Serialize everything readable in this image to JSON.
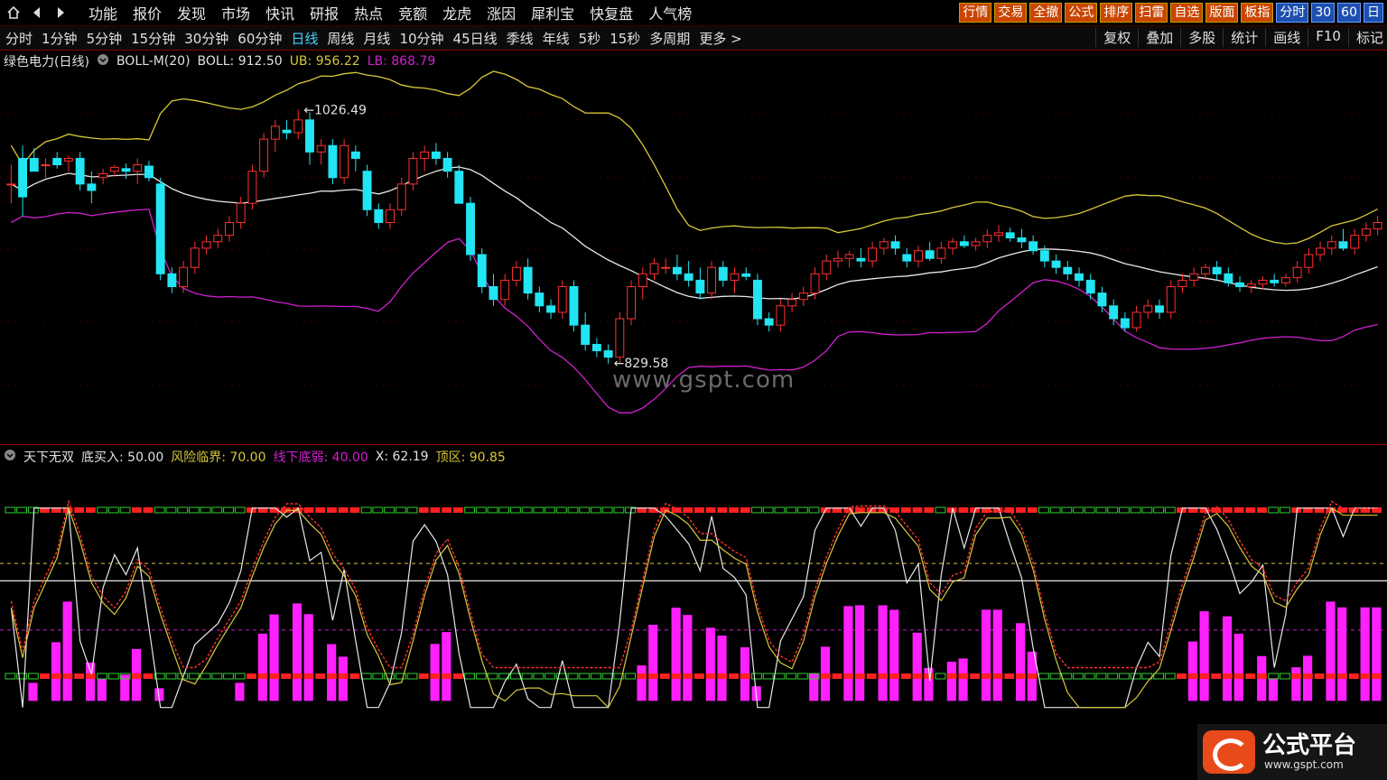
{
  "topbar": {
    "menu": [
      "功能",
      "报价",
      "发现",
      "市场",
      "快讯",
      "研报",
      "热点",
      "竞额",
      "龙虎",
      "涨因",
      "犀利宝",
      "快复盘",
      "人气榜"
    ],
    "buttons": [
      "行情",
      "交易",
      "全撤",
      "公式",
      "排序",
      "扫雷",
      "自选",
      "版面",
      "板指",
      "分时",
      "30",
      "60",
      "日"
    ]
  },
  "toolbar": {
    "periods": [
      "分时",
      "1分钟",
      "5分钟",
      "15分钟",
      "30分钟",
      "60分钟",
      "日线",
      "周线",
      "月线",
      "10分钟",
      "45日线",
      "季线",
      "年线",
      "5秒",
      "15秒",
      "多周期",
      "更多 >"
    ],
    "active": "日线",
    "right": [
      "复权",
      "叠加",
      "多股",
      "统计",
      "画线",
      "F10",
      "标记"
    ]
  },
  "main_legend": {
    "stock": "绿色电力(日线)",
    "indicator": "BOLL-M(20)",
    "boll": "BOLL: 912.50",
    "ub": "UB: 956.22",
    "lb": "LB: 868.79"
  },
  "price_labels": {
    "high": "1026.49",
    "low": "829.58"
  },
  "watermark": "www.gspt.com",
  "sub_legend": {
    "name": "天下无双",
    "buy": "底买入: 50.00",
    "risk": "风险临界: 70.00",
    "weak": "线下底弱: 40.00",
    "x": "X: 62.19",
    "top": "顶区: 90.85"
  },
  "logo": {
    "title": "公式平台",
    "url": "www.gspt.com"
  },
  "colors": {
    "up": "#ff3030",
    "down": "#22e4f2",
    "ub": "#d8c838",
    "mid": "#e8e8e8",
    "lb": "#d020d0",
    "accent": "#3fd2ff"
  },
  "chart_data": {
    "type": "candlestick",
    "title": "绿色电力(日线)",
    "indicator": "BOLL-M(20)",
    "boll": 912.5,
    "ub": 956.22,
    "lb": 868.79,
    "high_marker": 1026.49,
    "low_marker": 829.58,
    "candles": [
      [
        970,
        985,
        955,
        970
      ],
      [
        990,
        1000,
        945,
        960
      ],
      [
        990,
        998,
        980,
        980
      ],
      [
        985,
        990,
        975,
        985
      ],
      [
        990,
        995,
        982,
        985
      ],
      [
        988,
        992,
        980,
        990
      ],
      [
        990,
        995,
        965,
        970
      ],
      [
        970,
        980,
        955,
        965
      ],
      [
        975,
        982,
        970,
        978
      ],
      [
        980,
        985,
        976,
        983
      ],
      [
        982,
        986,
        974,
        980
      ],
      [
        980,
        990,
        970,
        985
      ],
      [
        984,
        988,
        972,
        975
      ],
      [
        970,
        975,
        895,
        900
      ],
      [
        900,
        905,
        885,
        890
      ],
      [
        890,
        910,
        885,
        905
      ],
      [
        905,
        925,
        900,
        920
      ],
      [
        920,
        930,
        915,
        925
      ],
      [
        925,
        935,
        920,
        930
      ],
      [
        930,
        945,
        925,
        940
      ],
      [
        940,
        960,
        935,
        955
      ],
      [
        955,
        985,
        950,
        980
      ],
      [
        980,
        1010,
        975,
        1005
      ],
      [
        1005,
        1020,
        995,
        1015
      ],
      [
        1012,
        1020,
        1005,
        1010
      ],
      [
        1010,
        1028,
        1005,
        1020
      ],
      [
        1020,
        1026,
        985,
        995
      ],
      [
        995,
        1005,
        985,
        1000
      ],
      [
        1000,
        1005,
        970,
        975
      ],
      [
        975,
        1005,
        970,
        1000
      ],
      [
        995,
        1000,
        980,
        990
      ],
      [
        980,
        985,
        945,
        950
      ],
      [
        950,
        955,
        935,
        940
      ],
      [
        940,
        955,
        935,
        950
      ],
      [
        950,
        975,
        945,
        970
      ],
      [
        970,
        995,
        965,
        990
      ],
      [
        990,
        1000,
        980,
        995
      ],
      [
        995,
        1002,
        985,
        990
      ],
      [
        990,
        995,
        975,
        980
      ],
      [
        980,
        985,
        960,
        955
      ],
      [
        955,
        960,
        910,
        915
      ],
      [
        915,
        920,
        885,
        890
      ],
      [
        890,
        900,
        875,
        880
      ],
      [
        880,
        900,
        875,
        895
      ],
      [
        895,
        910,
        890,
        905
      ],
      [
        905,
        912,
        880,
        885
      ],
      [
        885,
        890,
        870,
        875
      ],
      [
        875,
        880,
        865,
        870
      ],
      [
        870,
        895,
        865,
        890
      ],
      [
        890,
        895,
        855,
        860
      ],
      [
        860,
        870,
        840,
        845
      ],
      [
        845,
        850,
        835,
        840
      ],
      [
        840,
        845,
        830,
        835
      ],
      [
        835,
        870,
        830,
        865
      ],
      [
        865,
        895,
        860,
        890
      ],
      [
        890,
        905,
        880,
        900
      ],
      [
        900,
        912,
        895,
        908
      ],
      [
        905,
        912,
        900,
        905
      ],
      [
        905,
        915,
        895,
        900
      ],
      [
        900,
        910,
        890,
        895
      ],
      [
        895,
        905,
        880,
        885
      ],
      [
        885,
        910,
        880,
        905
      ],
      [
        905,
        910,
        890,
        895
      ],
      [
        895,
        905,
        885,
        900
      ],
      [
        900,
        905,
        895,
        898
      ],
      [
        895,
        900,
        860,
        865
      ],
      [
        865,
        870,
        855,
        860
      ],
      [
        860,
        880,
        855,
        875
      ],
      [
        875,
        885,
        870,
        880
      ],
      [
        880,
        890,
        875,
        885
      ],
      [
        885,
        905,
        880,
        900
      ],
      [
        900,
        915,
        895,
        910
      ],
      [
        910,
        918,
        905,
        912
      ],
      [
        912,
        918,
        905,
        915
      ],
      [
        912,
        920,
        905,
        910
      ],
      [
        910,
        925,
        905,
        920
      ],
      [
        920,
        928,
        915,
        925
      ],
      [
        925,
        930,
        915,
        920
      ],
      [
        915,
        920,
        905,
        910
      ],
      [
        910,
        922,
        905,
        918
      ],
      [
        918,
        925,
        910,
        912
      ],
      [
        912,
        925,
        908,
        920
      ],
      [
        920,
        928,
        915,
        925
      ],
      [
        925,
        930,
        920,
        922
      ],
      [
        922,
        928,
        918,
        925
      ],
      [
        925,
        935,
        920,
        930
      ],
      [
        930,
        938,
        925,
        932
      ],
      [
        932,
        936,
        925,
        928
      ],
      [
        928,
        935,
        920,
        925
      ],
      [
        925,
        930,
        915,
        918
      ],
      [
        918,
        922,
        905,
        910
      ],
      [
        910,
        915,
        900,
        905
      ],
      [
        905,
        910,
        895,
        900
      ],
      [
        900,
        905,
        890,
        895
      ],
      [
        895,
        900,
        880,
        885
      ],
      [
        885,
        890,
        870,
        875
      ],
      [
        875,
        880,
        860,
        865
      ],
      [
        865,
        870,
        855,
        858
      ],
      [
        858,
        875,
        855,
        870
      ],
      [
        870,
        880,
        865,
        875
      ],
      [
        875,
        880,
        865,
        870
      ],
      [
        870,
        895,
        865,
        890
      ],
      [
        890,
        900,
        885,
        895
      ],
      [
        895,
        905,
        890,
        900
      ],
      [
        900,
        908,
        895,
        905
      ],
      [
        905,
        910,
        895,
        900
      ],
      [
        900,
        905,
        890,
        893
      ],
      [
        893,
        898,
        886,
        890
      ],
      [
        890,
        895,
        885,
        892
      ],
      [
        892,
        898,
        888,
        895
      ],
      [
        895,
        900,
        890,
        893
      ],
      [
        893,
        900,
        890,
        897
      ],
      [
        897,
        910,
        893,
        905
      ],
      [
        905,
        920,
        900,
        915
      ],
      [
        915,
        925,
        910,
        920
      ],
      [
        920,
        930,
        915,
        925
      ],
      [
        925,
        935,
        918,
        920
      ],
      [
        920,
        935,
        915,
        930
      ],
      [
        930,
        940,
        925,
        935
      ],
      [
        935,
        945,
        930,
        940
      ]
    ],
    "sub_indicator": {
      "name": "天下无双",
      "lines": {
        "底买入": 50.0,
        "风险临界": 70.0,
        "线下底弱": 40.0,
        "X": 62.19,
        "顶区": 90.85
      }
    }
  }
}
